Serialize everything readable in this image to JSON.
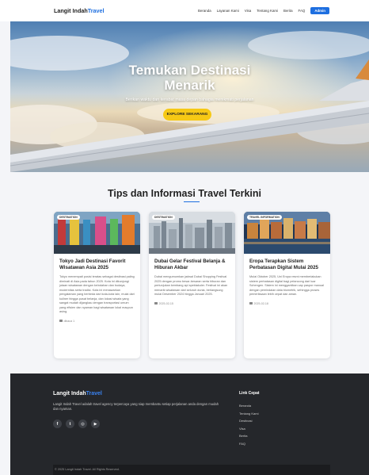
{
  "nav": {
    "logo_main": "Langit Indah",
    "logo_accent": "Travel",
    "items": [
      "Beranda",
      "Layanan Kami",
      "Visa",
      "Tentang Kami",
      "Berita",
      "FAQ"
    ],
    "admin_label": "Admin"
  },
  "hero": {
    "title_line1": "Temukan Destinasi",
    "title_line2": "Menarik",
    "subtitle": "Berikan waktu dan kerabat masa depan bahagia menikmati perjalanan",
    "cta_label": "EXPLORE SEKARANG"
  },
  "section": {
    "title": "Tips dan Informasi Travel Terkini"
  },
  "cards": [
    {
      "badge": "DESTINATION",
      "title": "Tokyo Jadi Destinasi Favorit Wisatawan Asia 2025",
      "text": "Tokyo menempati posisi teratas sebagai destinasi paling diminati di Asia pada tahun 2025. Kota ini dikunjungi jutaan wisatawan dengan keindahan dan budaya, modernitas serta tradisi. Kota ini menawarkan pengalaman yang berbeda dari kota-kota lain, mulai dari kuliner hingga pusat belanja, dan lokasi wisata yang sangat mudah dijangkau dengan transportasi umum yang efisien dan nyaman bagi wisatawan lokal maupun asing.",
      "date": "dibaca 1"
    },
    {
      "badge": "DESTINATION",
      "title": "Dubai Gelar Festival Belanja & Hiburan Akbar",
      "text": "Dubai mengumumkan jadwal Dubai Shopping Festival 2025 dengan promo besar-besaran serta hiburan dan pertunjukan kembang api spektakuler. Festival ini akan menarik wisatawan dari seluruh dunia, berlangsung mulai Desember 2024 hingga Januari 2025.",
      "date": "2025-02-15"
    },
    {
      "badge": "TRAVEL INFORMATION",
      "title": "Eropa Terapkan Sistem Perbatasan Digital Mulai 2025",
      "text": "Mulai Oktober 2025, Uni Eropa resmi memberlakukan sistem perbatasan digital bagi pelancong dari luar Schengen. Sistem ini menggantikan cap paspor manual dengan pemindaian data biometrik, sehingga proses pemeriksaan lebih cepat dan aman.",
      "date": "2025-02-18"
    }
  ],
  "footer": {
    "logo_main": "Langit Indah",
    "logo_accent": "Travel",
    "description": "Langit Indah Travel adalah travel agency terpercaya yang siap membantu setiap perjalanan anda dengan mudah dan nyaman.",
    "social": [
      "f",
      "t",
      "◎",
      "▶"
    ],
    "links_title": "Link Cepat",
    "links": [
      "Beranda",
      "Tentang Kami",
      "Destinasi",
      "Visa",
      "Berita",
      "FAQ"
    ],
    "copyright": "© 2025 Langit Indah Travel. All Rights Reserved."
  },
  "colors": {
    "accent": "#1e6fe0",
    "cta": "#f6c915",
    "footer_bg": "#25272b"
  }
}
